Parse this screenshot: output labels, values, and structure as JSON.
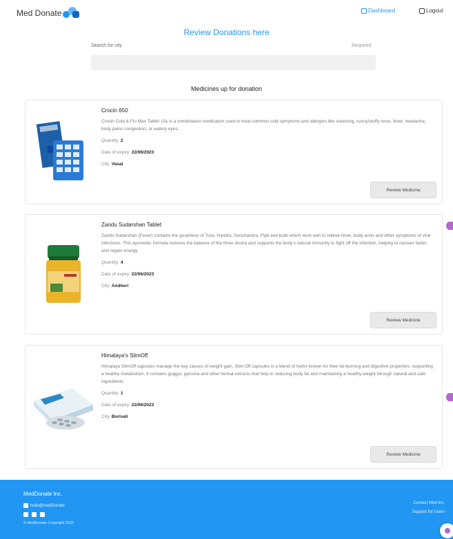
{
  "header": {
    "brand": "Med Donate",
    "dashboard_label": "Dashboard",
    "logout_label": "Logout"
  },
  "search": {
    "title": "Review Donations here",
    "label": "Search for city",
    "required_label": "Required",
    "placeholder": ""
  },
  "main": {
    "section_title": "Medicines up for donation",
    "quantity_label": "Quantity:",
    "expiry_label": "Date of expiry:",
    "city_label": "City:",
    "button_label": "Review Medicine",
    "medicines": [
      {
        "name": "Crocin 650",
        "description": "Crocin Cold & Flu Max Tablet 15s is a combination medication used to treat common cold symptoms and allergies like sneezing, runny/stuffy nose, fever, headache, body pains congestion, or watery eyes.",
        "quantity": "2",
        "expiry": "22/06/2023",
        "city": "Vasai"
      },
      {
        "name": "Zandu Sudarshan Tablet",
        "description": "Zandu Sudarshan (Fever) contains the goodness of Tulsi, Haridra, Sonchandra, Pipli and kutki which work well to relieve fever, body ache and other symptoms of viral infections. This ayurvedic formula restores the balance of the three dosha and supports the body's natural immunity to fight off the infection, helping to recover faster and regain energy.",
        "quantity": "4",
        "expiry": "22/06/2023",
        "city": "Andheri"
      },
      {
        "name": "Himalaya's SlimOff",
        "description": "Himalaya SlimOff capsules manage the key causes of weight gain. Slim Off capsules is a blend of herbs known for their fat-burning and digestive properties, supporting a healthy metabolism. It contains guggul, garcinia and other herbal extracts that help in reducing body fat and maintaining a healthy weight through natural and safe ingredients.",
        "quantity": "1",
        "expiry": "22/06/2023",
        "city": "Borivali"
      }
    ]
  },
  "footer": {
    "org_name": "MedDonate Inc.",
    "email": "hello@medDonate",
    "copyright": "© MedDonate Copyright 2023",
    "contact": "Contact Med Inc.",
    "support": "Support for Users"
  },
  "colors": {
    "accent": "#2196f3",
    "footer_bg": "#2196f3",
    "badge": "#b06bc9"
  },
  "icons": [
    "logo-icon",
    "dashboard-icon",
    "logout-icon",
    "mail-icon",
    "facebook-icon",
    "instagram-icon",
    "twitter-icon",
    "chat-icon"
  ]
}
